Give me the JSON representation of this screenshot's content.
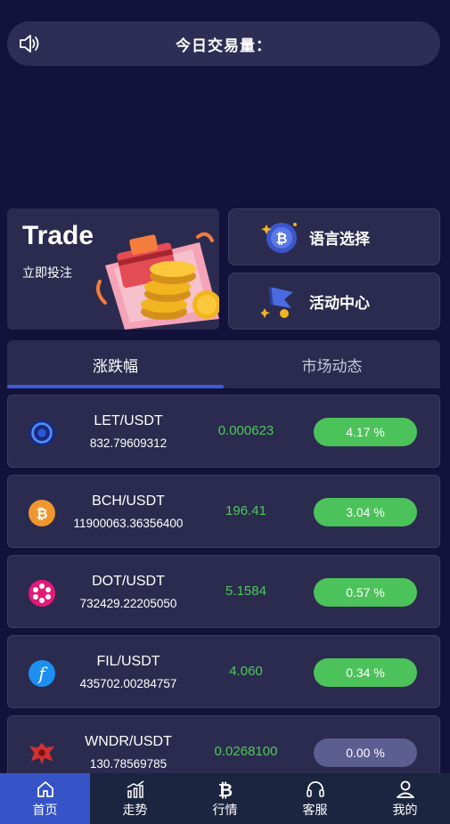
{
  "announcement": {
    "text": "今日交易量：",
    "icon": "speaker-icon"
  },
  "trade_card": {
    "title": "Trade",
    "subtitle": "立即投注"
  },
  "quick_links": [
    {
      "label": "语言选择",
      "icon": "bitcoin-coin-icon"
    },
    {
      "label": "活动中心",
      "icon": "flag-icon"
    }
  ],
  "tabs": [
    {
      "label": "涨跌幅",
      "active": true
    },
    {
      "label": "市场动态",
      "active": false
    }
  ],
  "markets": [
    {
      "pair": "LET/USDT",
      "volume": "832.79609312",
      "price": "0.000623",
      "change": "4.17 %",
      "icon": "let-coin-icon"
    },
    {
      "pair": "BCH/USDT",
      "volume": "11900063.36356400",
      "price": "196.41",
      "change": "3.04 %",
      "icon": "bch-coin-icon"
    },
    {
      "pair": "DOT/USDT",
      "volume": "732429.22205050",
      "price": "5.1584",
      "change": "0.57 %",
      "icon": "dot-coin-icon"
    },
    {
      "pair": "FIL/USDT",
      "volume": "435702.00284757",
      "price": "4.060",
      "change": "0.34 %",
      "icon": "fil-coin-icon"
    },
    {
      "pair": "WNDR/USDT",
      "volume": "130.78569785",
      "price": "0.0268100",
      "change": "0.00 %",
      "icon": "wndr-coin-icon"
    }
  ],
  "nav": [
    {
      "label": "首页",
      "icon": "home-icon",
      "active": true
    },
    {
      "label": "走势",
      "icon": "trend-chart-icon",
      "active": false
    },
    {
      "label": "行情",
      "icon": "bitcoin-icon",
      "active": false
    },
    {
      "label": "客服",
      "icon": "headset-icon",
      "active": false
    },
    {
      "label": "我的",
      "icon": "user-icon",
      "active": false
    }
  ],
  "colors": {
    "background": "#12123a",
    "card": "#2b2b4f",
    "up": "#4cc25b",
    "flat": "#5c5d90",
    "accent": "#3654c7"
  }
}
